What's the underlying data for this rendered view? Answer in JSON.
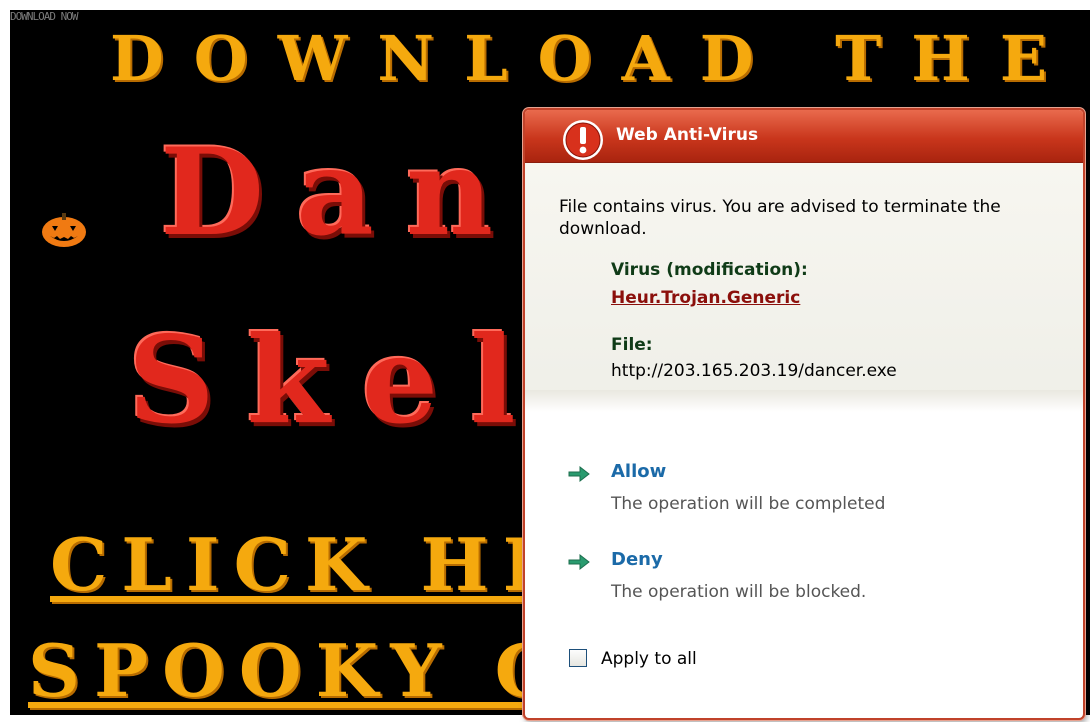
{
  "background_page": {
    "watermark": "DOWNLOAD NOW",
    "heading": "DOWNLOAD THE",
    "title_line1": "Danc",
    "title_line2": "Skele",
    "link_line1": "CLICK HERE",
    "link_line2": "SPOOKY GOO"
  },
  "av_dialog": {
    "title": "Web Anti-Virus",
    "message": "File contains virus. You are advised to terminate the download.",
    "virus_label": "Virus (modification):",
    "virus_name": "Heur.Trojan.Generic",
    "file_label": "File:",
    "file_url": "http://203.165.203.19/dancer.exe",
    "options": [
      {
        "label": "Allow",
        "description": "The operation will be completed"
      },
      {
        "label": "Deny",
        "description": "The operation will be blocked."
      }
    ],
    "apply_all_label": "Apply to all",
    "apply_all_checked": false,
    "icons": {
      "title": "alert-icon",
      "option": "green-arrow-icon"
    },
    "colors": {
      "title_bar": "#c9361c",
      "border": "#c0422a",
      "option_text": "#1b6aa8",
      "virus_name": "#8b0f0b",
      "label_text": "#0f3b17",
      "arrow": "#2a9b6f"
    }
  }
}
